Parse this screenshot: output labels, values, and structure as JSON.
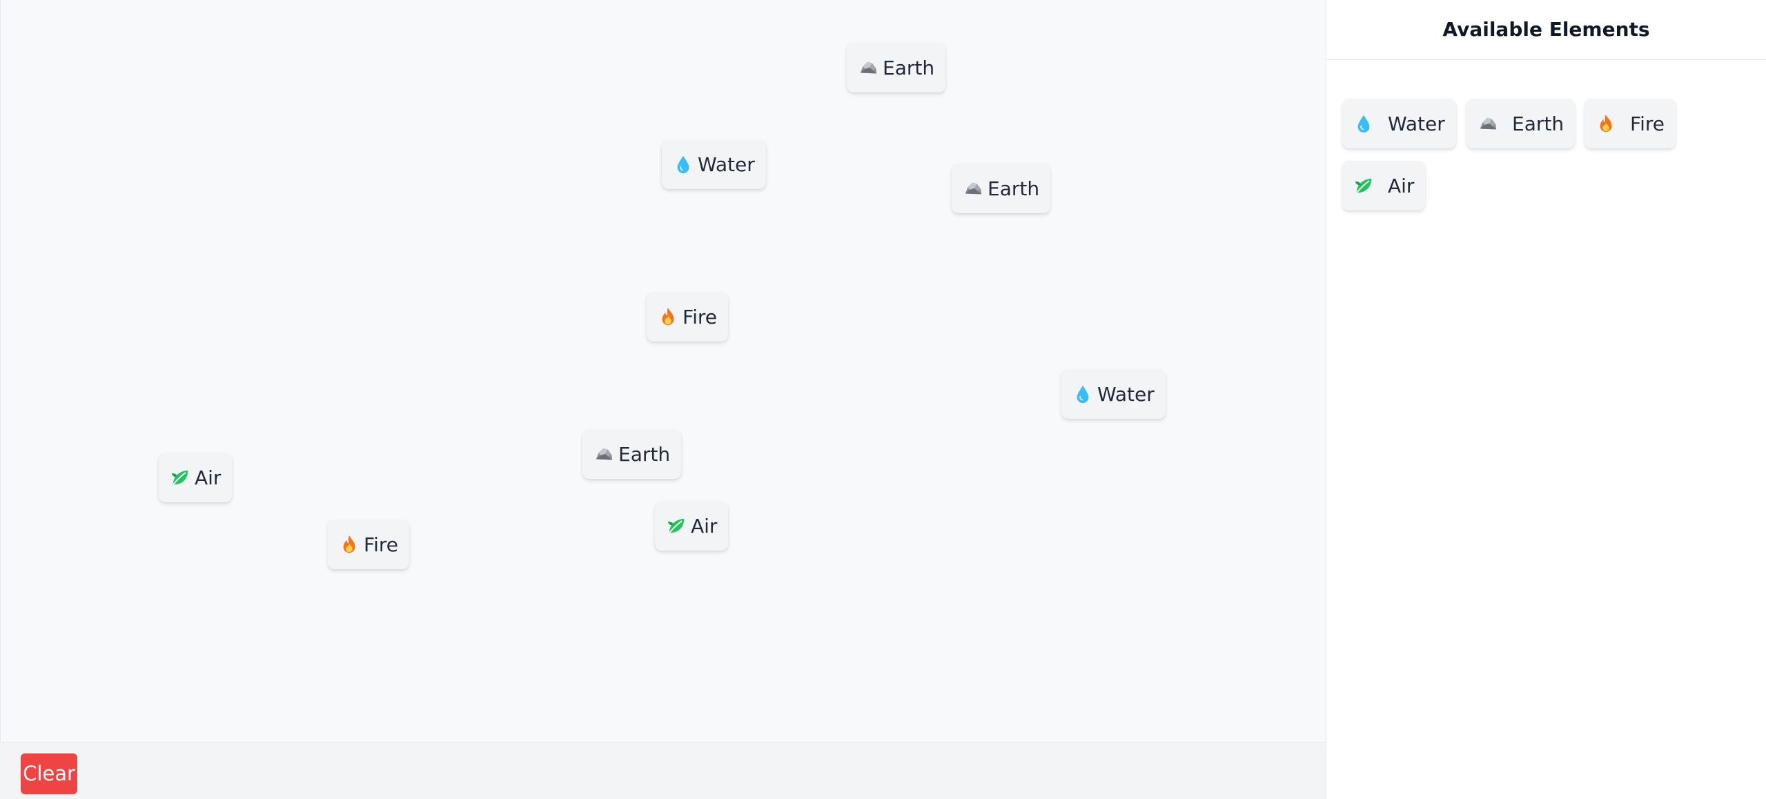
{
  "sidebar": {
    "title": "Available Elements",
    "items": [
      {
        "label": "Water",
        "icon": "water-drop-icon"
      },
      {
        "label": "Earth",
        "icon": "rock-icon"
      },
      {
        "label": "Fire",
        "icon": "fire-icon"
      },
      {
        "label": "Air",
        "icon": "leaf-icon"
      }
    ]
  },
  "canvas": {
    "elements": [
      {
        "label": "Earth",
        "icon": "rock-icon"
      },
      {
        "label": "Water",
        "icon": "water-drop-icon"
      },
      {
        "label": "Earth",
        "icon": "rock-icon"
      },
      {
        "label": "Fire",
        "icon": "fire-icon"
      },
      {
        "label": "Water",
        "icon": "water-drop-icon"
      },
      {
        "label": "Earth",
        "icon": "rock-icon"
      },
      {
        "label": "Air",
        "icon": "leaf-icon"
      },
      {
        "label": "Fire",
        "icon": "fire-icon"
      },
      {
        "label": "Air",
        "icon": "leaf-icon"
      }
    ]
  },
  "toolbar": {
    "clear_label": "Clear"
  },
  "colors": {
    "clear_button": "#ef4444",
    "canvas_bg": "#f8f9fb",
    "chip_bg": "#f3f4f6",
    "water": "#38bdf8",
    "fire": "#f97316",
    "leaf": "#22c55e",
    "rock": "#9ca3af"
  }
}
